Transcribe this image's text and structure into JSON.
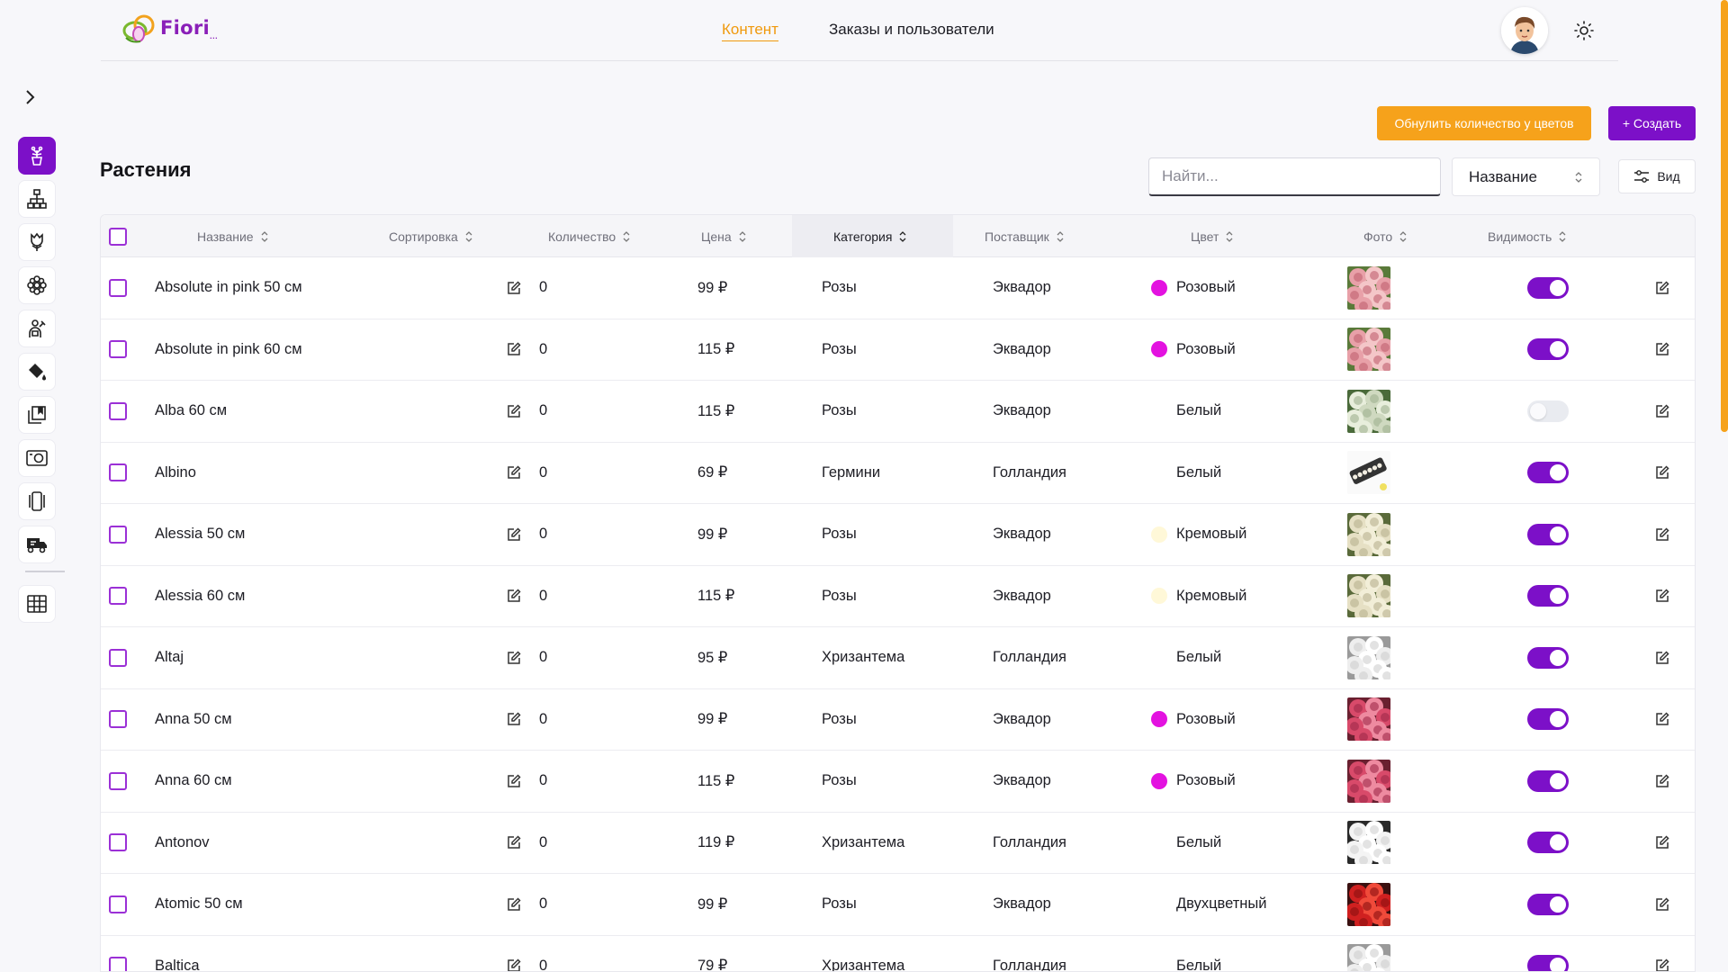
{
  "brand": {
    "logo_text": "Fiori",
    "logo_suffix": "..."
  },
  "top_nav": {
    "content": "Контент",
    "orders_users": "Заказы и пользователи"
  },
  "colors": {
    "accent": "#7c10c8",
    "orange": "#f6a21b",
    "pink_dot": "#e312e0",
    "white_dot": "#ffffff",
    "cream_dot": "#fff8d8"
  },
  "rail_icons": [
    "plant-pot-icon",
    "hierarchy-icon",
    "tulip-icon",
    "flower-icon",
    "florist-icon",
    "paint-bucket-icon",
    "copy-icon",
    "photo-camera-icon",
    "carousel-icon",
    "delivery-truck-icon",
    "table-grid-icon"
  ],
  "toolbar": {
    "reset_label": "Обнулить количество у цветов",
    "create_label": "+ Создать",
    "page_title": "Растения",
    "search_placeholder": "Найти...",
    "sort_value": "Название",
    "view_label": "Вид"
  },
  "table": {
    "headers": {
      "name": "Название",
      "sort": "Сортировка",
      "qty": "Количество",
      "price": "Цена",
      "category": "Категория",
      "supplier": "Поставщик",
      "color": "Цвет",
      "photo": "Фото",
      "visibility": "Видимость"
    },
    "rows": [
      {
        "name": "Absolute in pink 50 см",
        "qty": "0",
        "price": "99 ₽",
        "category": "Розы",
        "supplier": "Эквадор",
        "color": "Розовый",
        "dot": "#e312e0",
        "thumb": "pink",
        "visible": true
      },
      {
        "name": "Absolute in pink 60 см",
        "qty": "0",
        "price": "115 ₽",
        "category": "Розы",
        "supplier": "Эквадор",
        "color": "Розовый",
        "dot": "#e312e0",
        "thumb": "pink",
        "visible": true
      },
      {
        "name": "Alba 60 см",
        "qty": "0",
        "price": "115 ₽",
        "category": "Розы",
        "supplier": "Эквадор",
        "color": "Белый",
        "dot": "#ffffff",
        "thumb": "white",
        "visible": false
      },
      {
        "name": "Albino",
        "qty": "0",
        "price": "69 ₽",
        "category": "Гермини",
        "supplier": "Голландия",
        "color": "Белый",
        "dot": "#ffffff",
        "thumb": "box",
        "visible": true
      },
      {
        "name": "Alessia 50 см",
        "qty": "0",
        "price": "99 ₽",
        "category": "Розы",
        "supplier": "Эквадор",
        "color": "Кремовый",
        "dot": "#fff8d8",
        "thumb": "cream",
        "visible": true
      },
      {
        "name": "Alessia 60 см",
        "qty": "0",
        "price": "115 ₽",
        "category": "Розы",
        "supplier": "Эквадор",
        "color": "Кремовый",
        "dot": "#fff8d8",
        "thumb": "cream",
        "visible": true
      },
      {
        "name": "Altaj",
        "qty": "0",
        "price": "95 ₽",
        "category": "Хризантема",
        "supplier": "Голландия",
        "color": "Белый",
        "dot": "#ffffff",
        "thumb": "chrys",
        "visible": true
      },
      {
        "name": "Anna 50 см",
        "qty": "0",
        "price": "99 ₽",
        "category": "Розы",
        "supplier": "Эквадор",
        "color": "Розовый",
        "dot": "#e312e0",
        "thumb": "rose",
        "visible": true
      },
      {
        "name": "Anna 60 см",
        "qty": "0",
        "price": "115 ₽",
        "category": "Розы",
        "supplier": "Эквадор",
        "color": "Розовый",
        "dot": "#e312e0",
        "thumb": "rose",
        "visible": true
      },
      {
        "name": "Antonov",
        "qty": "0",
        "price": "119 ₽",
        "category": "Хризантема",
        "supplier": "Голландия",
        "color": "Белый",
        "dot": "#ffffff",
        "thumb": "chrysdark",
        "visible": true
      },
      {
        "name": "Atomic 50 см",
        "qty": "0",
        "price": "99 ₽",
        "category": "Розы",
        "supplier": "Эквадор",
        "color": "Двухцветный",
        "dot": "",
        "thumb": "red",
        "visible": true
      },
      {
        "name": "Baltica",
        "qty": "0",
        "price": "79 ₽",
        "category": "Хризантема",
        "supplier": "Голландия",
        "color": "Белый",
        "dot": "#ffffff",
        "thumb": "chrys",
        "visible": true
      }
    ]
  }
}
